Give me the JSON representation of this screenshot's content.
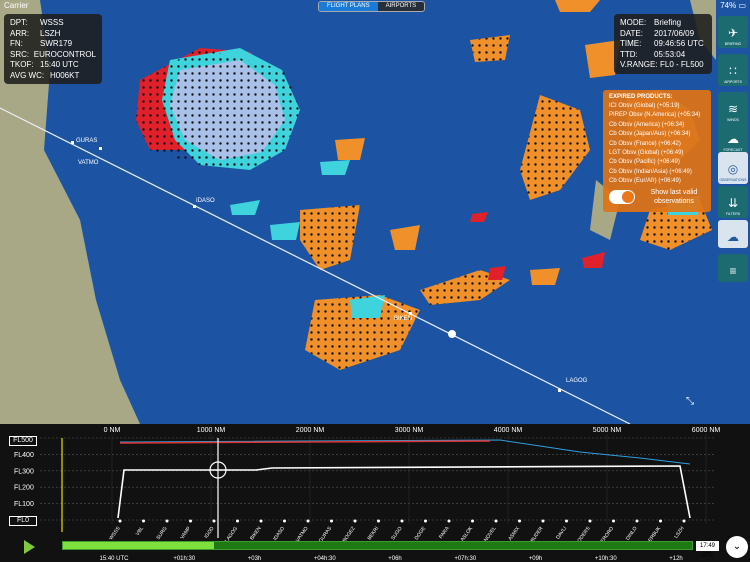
{
  "status": {
    "carrier": "Carrier",
    "battery": "74% ▭"
  },
  "tabs": {
    "flight_plans": "FLIGHT PLANS",
    "airports": "AIRPORTS"
  },
  "flight": {
    "labels": [
      "DPT:",
      "ARR:",
      "FN:",
      "SRC:",
      "TKOF:",
      "AVG WC:"
    ],
    "values": [
      "WSSS",
      "LSZH",
      "SWR179",
      "EUROCONTROL",
      "15:40 UTC",
      "H006KT"
    ]
  },
  "time": {
    "labels": [
      "MODE:",
      "DATE:",
      "TIME:",
      "TTD:",
      "V.RANGE:"
    ],
    "values": [
      "Briefing",
      "2017/06/09",
      "09:46:56 UTC",
      "05:53:04",
      "FL0 - FL500"
    ]
  },
  "expired": {
    "title": "EXPIRED PRODUCTS:",
    "items": [
      "ICI Obsv (Global) (+05:19)",
      "PIREP Obsv (N.America) (+05:34)",
      "Cb Obsv (America) (+06:34)",
      "Cb Obsv (Japan/Aus) (+06:34)",
      "Cb Obsv (France) (+06:42)",
      "LGT Obsv (Global) (+06:49)",
      "Cb Obsv (Pacific) (+06:49)",
      "Cb Obsv (Indian/Asia) (+06:49)",
      "Cb Obsv (Eur/Afr) (+06:49)"
    ],
    "toggle_label": "Show last valid observations",
    "toggle_on": true
  },
  "sidebar": [
    {
      "label": "BRIEFING",
      "icon": "✈"
    },
    {
      "label": "AIRPORTS",
      "icon": "∷"
    },
    {
      "label": "WINDS",
      "icon": "≋"
    },
    {
      "label": "FORECAST",
      "icon": "☁"
    },
    {
      "label": "OBSERVATIONS",
      "icon": "◎"
    },
    {
      "label": "FILTERS",
      "icon": "⇊"
    },
    {
      "label": "",
      "icon": "☁"
    },
    {
      "label": "",
      "icon": "≡"
    }
  ],
  "waypoints_map": [
    "GURAS",
    "VATMO",
    "IDASO",
    "BIKEN",
    "LAGOG"
  ],
  "profile": {
    "fl_labels": [
      "FL500",
      "FL400",
      "FL300",
      "FL200",
      "FL100",
      "FL0"
    ],
    "nm_ticks": [
      "0 NM",
      "1000 NM",
      "2000 NM",
      "3000 NM",
      "4000 NM",
      "5000 NM",
      "6000 NM"
    ],
    "time_ticks": [
      "15:40 UTC",
      "+01h:30",
      "+03h",
      "+04h:30",
      "+06h",
      "+07h:30",
      "+09h",
      "+10h:30",
      "+12h"
    ],
    "waypoints": [
      "WSSS",
      "VBL",
      "SURG",
      "VAMP",
      "IGOD",
      "LAGOG",
      "BIKEN",
      "IDASO",
      "VATMO",
      "GURAS",
      "BOGEZ",
      "BEKRI",
      "SUGO",
      "DOGE",
      "PARA",
      "ASLOK",
      "NOVEL",
      "ASMIX",
      "BUDER",
      "DAVLI",
      "ODERS",
      "ERORO",
      "DINLO",
      "ERBUK",
      "LSZH"
    ],
    "current_time": "17:49 UTC",
    "progress": 0.24
  }
}
